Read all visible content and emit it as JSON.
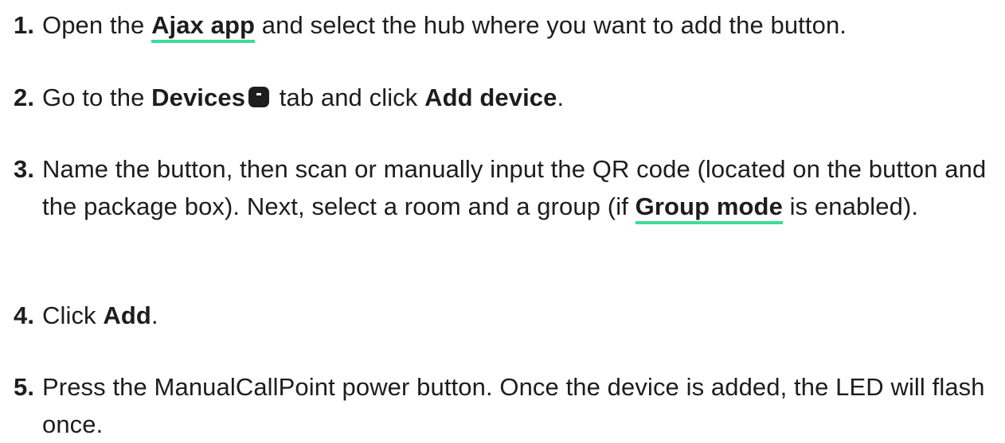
{
  "steps": [
    {
      "number": "1.",
      "t1": "Open the ",
      "link": "Ajax app",
      "t2": " and select the hub where you want to add the button."
    },
    {
      "number": "2.",
      "t1": "Go to the ",
      "b1": "Devices",
      "icon": "devices-tab-icon",
      "t2": " tab and click ",
      "b2": "Add device",
      "t3": "."
    },
    {
      "number": "3.",
      "t1": "Name the button, then scan or manually input the QR code (located on the button and the package box). Next, select a room and a group (if ",
      "link": "Group mode",
      "t2": " is enabled)."
    },
    {
      "number": "4.",
      "t1": "Click ",
      "b1": "Add",
      "t2": "."
    },
    {
      "number": "5.",
      "t1": "Press the ManualCallPoint power button. Once the device is added, the LED will flash once."
    }
  ],
  "colors": {
    "text": "#1d1d1f",
    "link_underline": "#3ddc97",
    "background": "#ffffff"
  }
}
